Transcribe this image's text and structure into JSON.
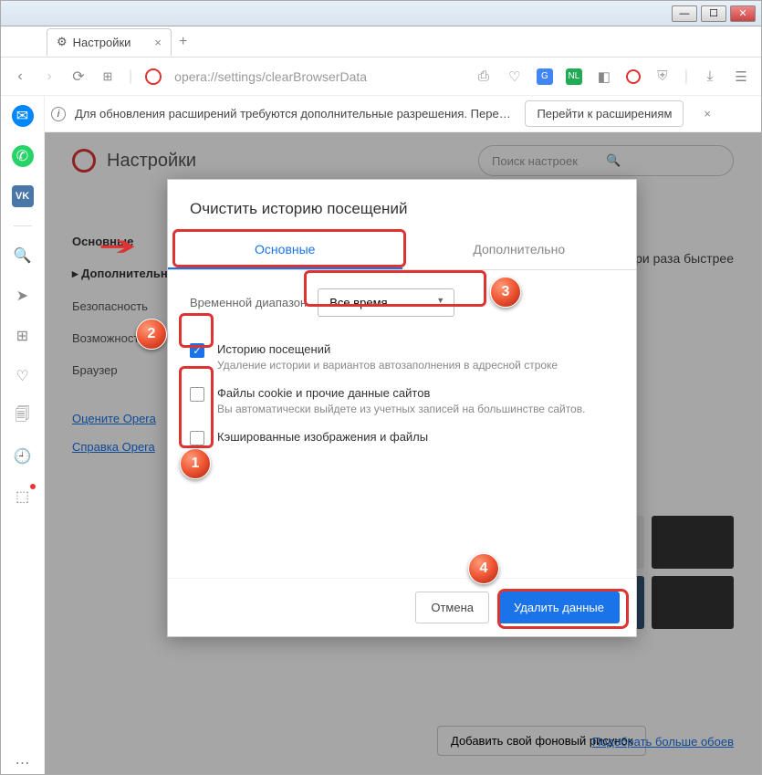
{
  "window": {
    "tab_title": "Настройки",
    "url": "opera://settings/clearBrowserData"
  },
  "infobar": {
    "text": "Для обновления расширений требуются дополнительные разрешения. Перейдите в...",
    "action": "Перейти к расширениям"
  },
  "page": {
    "title": "Настройки",
    "search_placeholder": "Поиск настроек",
    "nav": {
      "basic": "Основные",
      "advanced": "Дополнительно",
      "security": "Безопасность",
      "features": "Возможности",
      "browser": "Браузер"
    },
    "links": {
      "rate": "Оцените Opera",
      "help": "Справка Opera"
    },
    "bg_teaser": "...е в три раза быстрее",
    "bg_add_btn": "Добавить свой фоновый рисунок",
    "bg_more_link": "Подобрать больше обоев"
  },
  "dialog": {
    "title": "Очистить историю посещений",
    "tabs": {
      "basic": "Основные",
      "advanced": "Дополнительно"
    },
    "range_label": "Временной диапазон",
    "range_value": "Все время",
    "options": {
      "history": {
        "label": "Историю посещений",
        "sub": "Удаление истории и вариантов автозаполнения в адресной строке"
      },
      "cookies": {
        "label": "Файлы cookie и прочие данные сайтов",
        "sub": "Вы автоматически выйдете из учетных записей на большинстве сайтов."
      },
      "cache": {
        "label": "Кэшированные изображения и файлы"
      }
    },
    "buttons": {
      "cancel": "Отмена",
      "confirm": "Удалить данные"
    }
  },
  "markers": {
    "m1": "1",
    "m2": "2",
    "m3": "3",
    "m4": "4"
  }
}
